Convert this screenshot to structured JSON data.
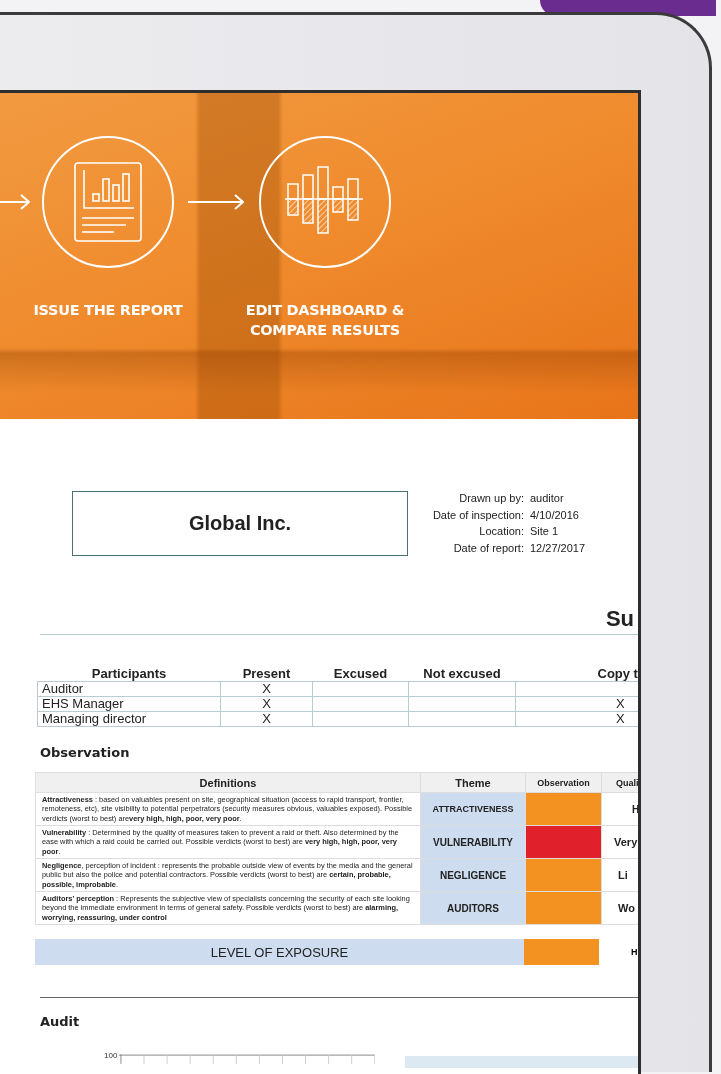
{
  "hero": {
    "steps": [
      {
        "label": "ISSUE THE REPORT"
      },
      {
        "label": "EDIT DASHBOARD &\nCOMPARE RESULTS"
      }
    ]
  },
  "report": {
    "company": "Global Inc.",
    "meta": [
      {
        "label": "Drawn up by:",
        "value": "auditor"
      },
      {
        "label": "Date of inspection:",
        "value": "4/10/2016"
      },
      {
        "label": "Location:",
        "value": "Site 1"
      },
      {
        "label": "Date of report:",
        "value": "12/27/2017"
      }
    ],
    "section_title": "Su",
    "participants": {
      "columns": [
        "Participants",
        "Present",
        "Excused",
        "Not excused",
        "Copy t"
      ],
      "rows": [
        [
          "Auditor",
          "X",
          "",
          "",
          ""
        ],
        [
          "EHS Manager",
          "X",
          "",
          "",
          "X"
        ],
        [
          "Managing director",
          "X",
          "",
          "",
          "X"
        ]
      ]
    },
    "observation_heading": "Observation",
    "definitions": {
      "columns": [
        "Definitions",
        "Theme",
        "Observation",
        "Quali"
      ],
      "rows": [
        {
          "definition": "**Attractiveness** : based on valuables present on site, geographical situation (access to rapid transport, frontier, remoteness, etc), site visibility to potential perpetrators (security measures obvious, valuables exposed). Possible verdicts (worst to best) are**very high, high, poor, very poor**.",
          "theme": "ATTRACTIVENESS",
          "color": "#f39220",
          "quality": "H"
        },
        {
          "definition": "**Vulnerability** : Determined by the quality of measures taken to prevent a raid or theft. Also determined by the ease with which a raid could be carried out. Possible verdicts (worst to best) are **very high, high, poor, very poor**.",
          "theme": "VULNERABILITY",
          "color": "#e0202a",
          "quality": "Very"
        },
        {
          "definition": "**Negligence**, perception of incident : represents the probable outside view of events by the media and the general public but also the police and potential contractors. Possible verdicts (worst to best) are **certain, probable, possible, improbable**.",
          "theme": "NEGLIGENCE",
          "color": "#f39220",
          "quality": "Li"
        },
        {
          "definition": "**Auditors' perception** : Represents the subjective view of specialists concerning the security of each site looking beyond the immediate environment in terms of general safety. Possible verdicts (worst to best) are **alarming, worrying, reassuring, under control**",
          "theme": "AUDITORS",
          "color": "#f39220",
          "quality": "Wo"
        }
      ]
    },
    "exposure": {
      "label": "LEVEL OF EXPOSURE",
      "color": "#f39220",
      "quality": "H"
    },
    "audit_heading": "Audit",
    "audit_chart_tick": "100"
  }
}
